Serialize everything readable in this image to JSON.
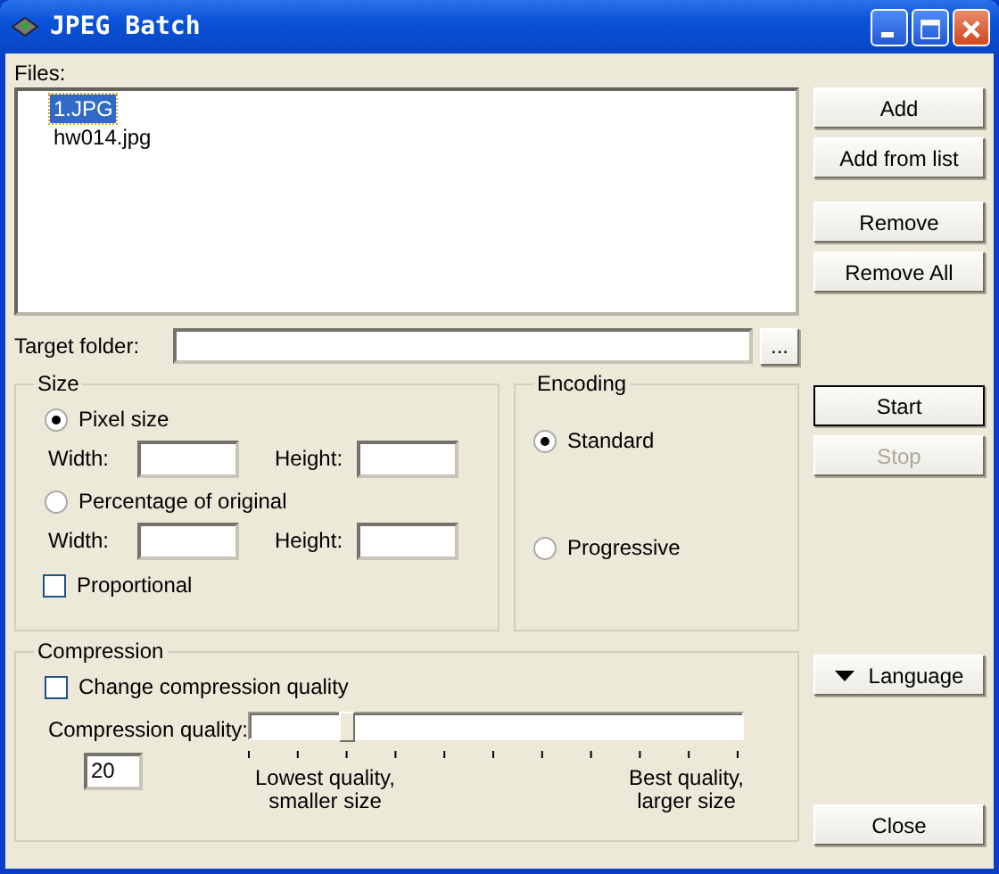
{
  "window": {
    "title": "JPEG Batch"
  },
  "files": {
    "label": "Files:",
    "items": [
      {
        "name": "1.JPG",
        "selected": true
      },
      {
        "name": "hw014.jpg",
        "selected": false
      }
    ]
  },
  "file_button_groups": [
    {
      "buttons": [
        {
          "label": "Add"
        },
        {
          "label": "Add from list"
        }
      ]
    },
    {
      "buttons": [
        {
          "label": "Remove"
        },
        {
          "label": "Remove All"
        }
      ]
    }
  ],
  "target_folder": {
    "label": "Target folder:",
    "browse": "..."
  },
  "size": {
    "title": "Size",
    "options": [
      {
        "label": "Pixel size",
        "selected": true,
        "width_label": "Width:",
        "height_label": "Height:"
      },
      {
        "label": "Percentage of original",
        "selected": false,
        "width_label": "Width:",
        "height_label": "Height:"
      }
    ],
    "proportional": {
      "label": "Proportional",
      "checked": false
    }
  },
  "encoding": {
    "title": "Encoding",
    "options": [
      {
        "label": "Standard",
        "selected": true
      },
      {
        "label": "Progressive",
        "selected": false
      }
    ]
  },
  "run_buttons": [
    {
      "label": "Start",
      "disabled": false,
      "default": true
    },
    {
      "label": "Stop",
      "disabled": true,
      "default": false
    }
  ],
  "compression": {
    "title": "Compression",
    "change": {
      "label": "Change compression quality",
      "checked": false
    },
    "quality_label": "Compression quality:",
    "value": "20",
    "level": 0.2,
    "low_caption": "Lowest quality,\nsmaller size",
    "high_caption": "Best quality,\nlarger size"
  },
  "language_button": {
    "label": "Language"
  },
  "close_button": {
    "label": "Close"
  }
}
